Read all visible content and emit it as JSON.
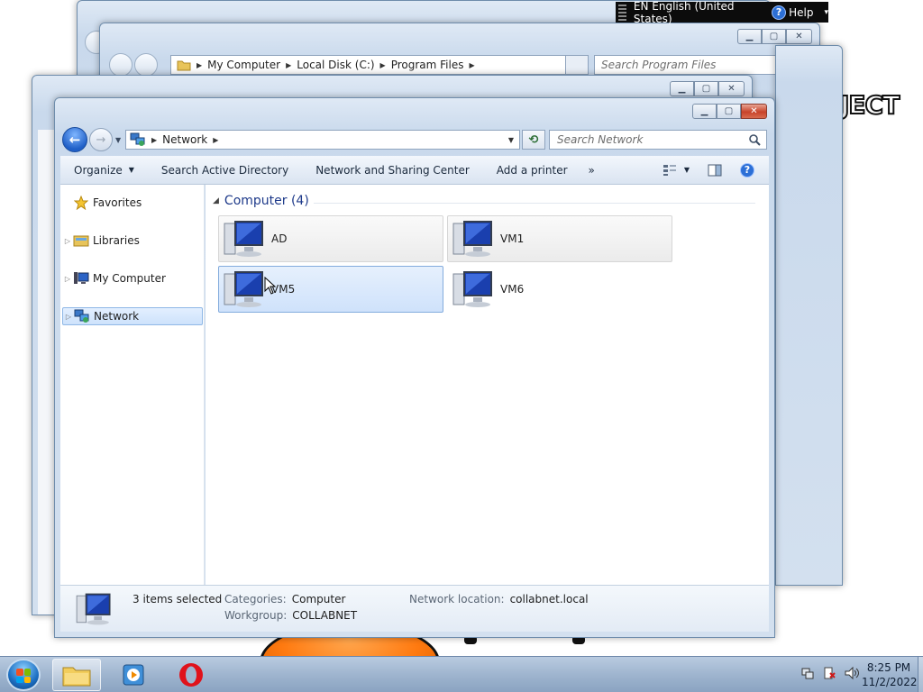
{
  "language_bar": {
    "language": "EN English (United States)",
    "help": "Help"
  },
  "desktop": {
    "banner_text": "JECT"
  },
  "background_window": {
    "breadcrumb": [
      "My Computer",
      "Local Disk (C:)",
      "Program Files"
    ],
    "search_placeholder": "Search Program Files"
  },
  "main_window": {
    "address": {
      "crumbs": [
        "Network"
      ]
    },
    "search_placeholder": "Search Network",
    "toolbar": {
      "organize": "Organize",
      "search_ad": "Search Active Directory",
      "network_sharing": "Network and Sharing Center",
      "add_printer": "Add a printer",
      "more": "»"
    },
    "nav_pane": {
      "items": [
        {
          "label": "Favorites",
          "icon": "star-icon"
        },
        {
          "label": "Libraries",
          "icon": "libraries-icon"
        },
        {
          "label": "My Computer",
          "icon": "computer-icon"
        },
        {
          "label": "Network",
          "icon": "network-icon",
          "selected": true
        }
      ]
    },
    "group": {
      "title": "Computer (4)"
    },
    "computers": [
      {
        "name": "AD",
        "state": "selected-grey"
      },
      {
        "name": "VM1",
        "state": "selected-grey"
      },
      {
        "name": "VM5",
        "state": "hover-selected"
      },
      {
        "name": "VM6",
        "state": "normal"
      }
    ],
    "details": {
      "count": "3 items selected",
      "categories_label": "Categories:",
      "categories_value": "Computer",
      "workgroup_label": "Workgroup:",
      "workgroup_value": "COLLABNET",
      "location_label": "Network location:",
      "location_value": "collabnet.local"
    }
  },
  "taskbar": {
    "time": "8:25 PM",
    "date": "11/2/2022"
  },
  "colors": {
    "accent": "#1e3a8a",
    "selection": "#cfe2fb",
    "taskbar": "#9fb5cf"
  }
}
